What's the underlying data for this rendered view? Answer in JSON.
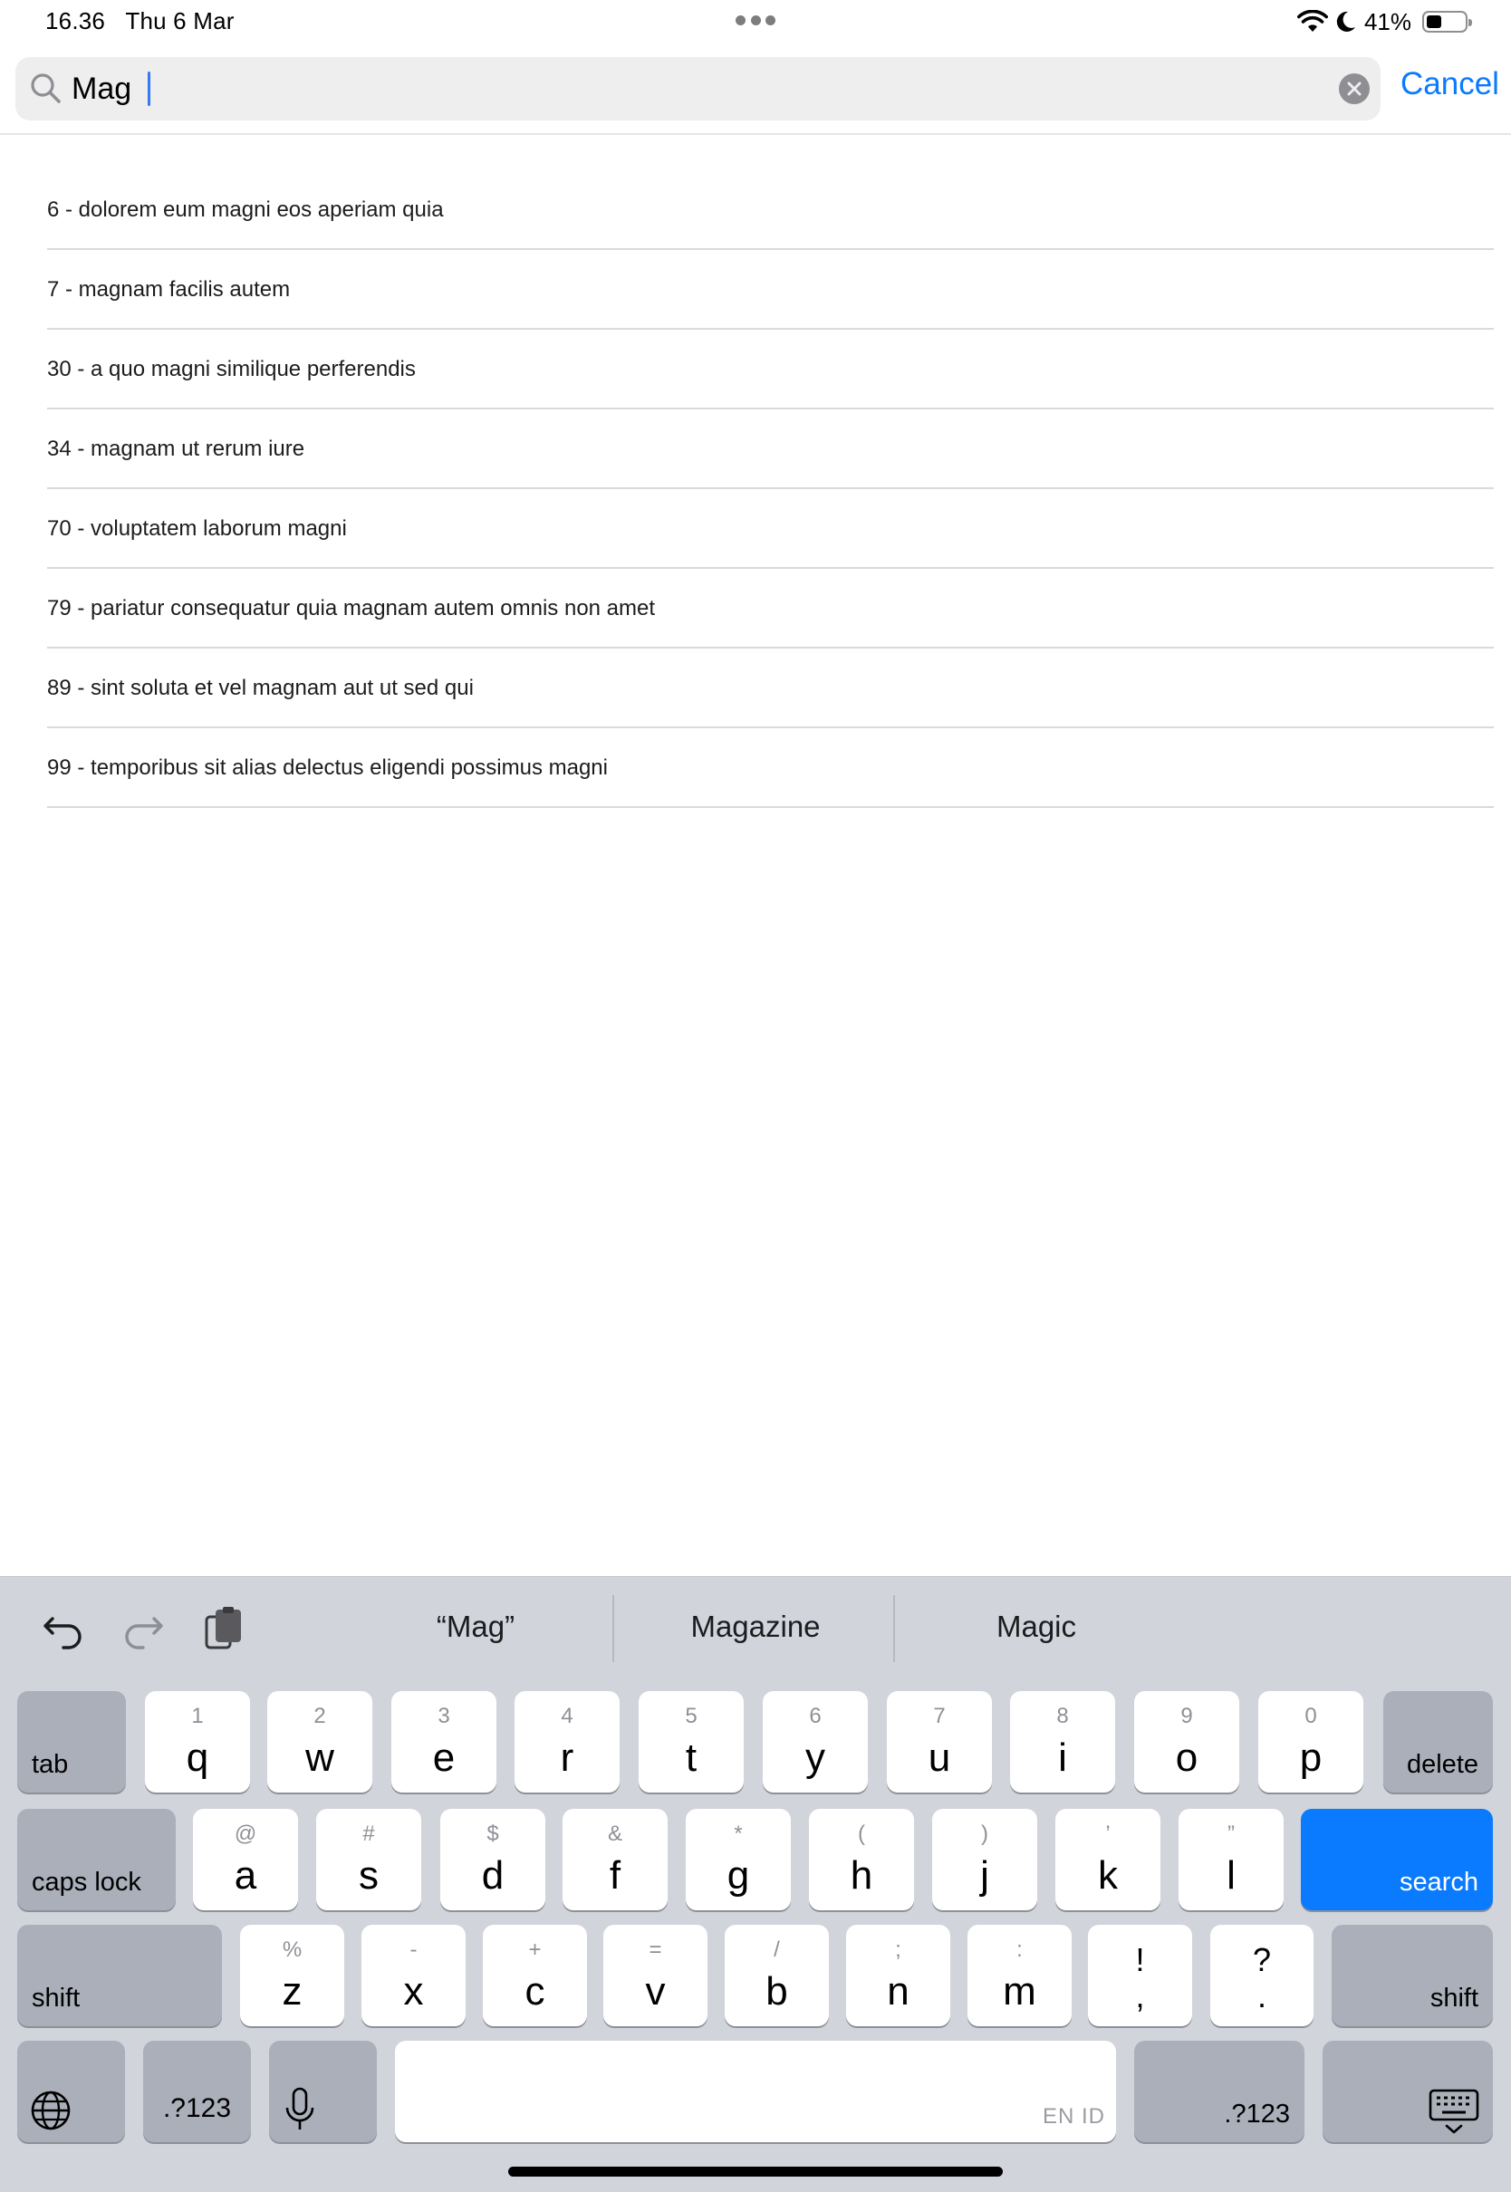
{
  "status_bar": {
    "time": "16.36",
    "date": "Thu 6 Mar",
    "battery_percent": "41%",
    "battery_level": 0.41
  },
  "search": {
    "query": "Mag",
    "cancel_label": "Cancel"
  },
  "results": [
    "6 - dolorem eum magni eos aperiam quia",
    "7 - magnam facilis autem",
    "30 - a quo magni similique perferendis",
    "34 - magnam ut rerum iure",
    "70 - voluptatem laborum magni",
    "79 - pariatur consequatur quia magnam autem omnis non amet",
    "89 - sint soluta et vel magnam aut ut sed qui",
    "99 - temporibus sit alias delectus eligendi possimus magni"
  ],
  "keyboard": {
    "suggestions": [
      "“Mag”",
      "Magazine",
      "Magic"
    ],
    "row1": [
      {
        "alt": "1",
        "main": "q"
      },
      {
        "alt": "2",
        "main": "w"
      },
      {
        "alt": "3",
        "main": "e"
      },
      {
        "alt": "4",
        "main": "r"
      },
      {
        "alt": "5",
        "main": "t"
      },
      {
        "alt": "6",
        "main": "y"
      },
      {
        "alt": "7",
        "main": "u"
      },
      {
        "alt": "8",
        "main": "i"
      },
      {
        "alt": "9",
        "main": "o"
      },
      {
        "alt": "0",
        "main": "p"
      }
    ],
    "row2": [
      {
        "alt": "@",
        "main": "a"
      },
      {
        "alt": "#",
        "main": "s"
      },
      {
        "alt": "$",
        "main": "d"
      },
      {
        "alt": "&",
        "main": "f"
      },
      {
        "alt": "*",
        "main": "g"
      },
      {
        "alt": "(",
        "main": "h"
      },
      {
        "alt": ")",
        "main": "j"
      },
      {
        "alt": "’",
        "main": "k"
      },
      {
        "alt": "”",
        "main": "l"
      }
    ],
    "row3": [
      {
        "alt": "%",
        "main": "z"
      },
      {
        "alt": "-",
        "main": "x"
      },
      {
        "alt": "+",
        "main": "c"
      },
      {
        "alt": "=",
        "main": "v"
      },
      {
        "alt": "/",
        "main": "b"
      },
      {
        "alt": ";",
        "main": "n"
      },
      {
        "alt": ":",
        "main": "m"
      }
    ],
    "punct1": {
      "top": "!",
      "bottom": ","
    },
    "punct2": {
      "top": "?",
      "bottom": "."
    },
    "tab_label": "tab",
    "delete_label": "delete",
    "caps_label": "caps lock",
    "search_label": "search",
    "shift_label": "shift",
    "numbers_label": ".?123",
    "space_lang": "EN ID",
    "icons": [
      "undo-icon",
      "redo-icon",
      "clipboard-icon",
      "globe-icon",
      "microphone-icon",
      "keyboard-dismiss-icon",
      "search-icon",
      "clear-icon",
      "wifi-icon",
      "moon-icon",
      "battery-icon"
    ]
  }
}
